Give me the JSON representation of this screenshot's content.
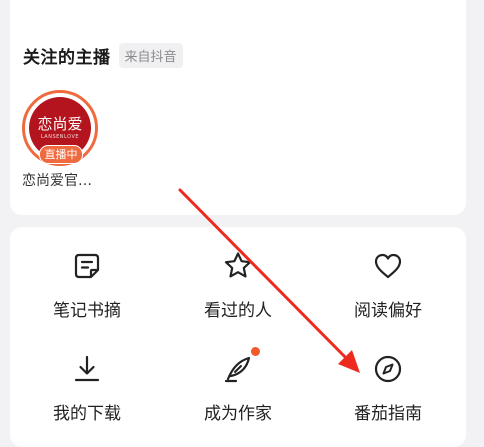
{
  "followed_anchors": {
    "title": "关注的主播",
    "source_badge": "来自抖音",
    "anchors": [
      {
        "name": "恋尚爱官…",
        "live_badge": "直播中",
        "avatar_logo": "恋尚爱",
        "avatar_sub": "LANSENLOVE"
      }
    ]
  },
  "menu": {
    "items": [
      {
        "label": "笔记书摘",
        "icon": "note-icon"
      },
      {
        "label": "看过的人",
        "icon": "star-icon"
      },
      {
        "label": "阅读偏好",
        "icon": "heart-icon"
      },
      {
        "label": "我的下载",
        "icon": "download-icon"
      },
      {
        "label": "成为作家",
        "icon": "quill-icon",
        "has_dot": true
      },
      {
        "label": "番茄指南",
        "icon": "compass-icon"
      }
    ]
  },
  "colors": {
    "accent": "#f06a3f",
    "notification_dot": "#f25a2c",
    "arrow": "#ee2a1f"
  }
}
